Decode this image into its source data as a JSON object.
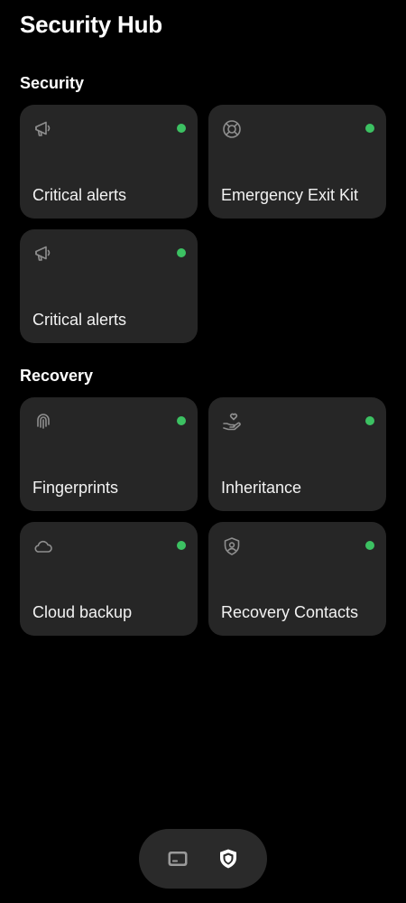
{
  "header": {
    "title": "Security Hub"
  },
  "sections": {
    "security": {
      "title": "Security",
      "items": [
        {
          "label": "Critical alerts",
          "icon": "megaphone-icon",
          "status": "active"
        },
        {
          "label": "Emergency Exit Kit",
          "icon": "lifebuoy-icon",
          "status": "active"
        },
        {
          "label": "Critical alerts",
          "icon": "megaphone-icon",
          "status": "active"
        }
      ]
    },
    "recovery": {
      "title": "Recovery",
      "items": [
        {
          "label": "Fingerprints",
          "icon": "fingerprint-icon",
          "status": "active"
        },
        {
          "label": "Inheritance",
          "icon": "hand-heart-icon",
          "status": "active"
        },
        {
          "label": "Cloud backup",
          "icon": "cloud-icon",
          "status": "active"
        },
        {
          "label": "Recovery Contacts",
          "icon": "shield-user-icon",
          "status": "active"
        }
      ]
    }
  },
  "bottom_nav": {
    "items": [
      {
        "icon": "card-icon",
        "selected": false
      },
      {
        "icon": "shield-icon",
        "selected": true
      }
    ]
  },
  "colors": {
    "background": "#000000",
    "card_background": "#262626",
    "status_active": "#3cc162",
    "icon_muted": "#8e8e8e",
    "nav_background": "#2a2a2a"
  }
}
